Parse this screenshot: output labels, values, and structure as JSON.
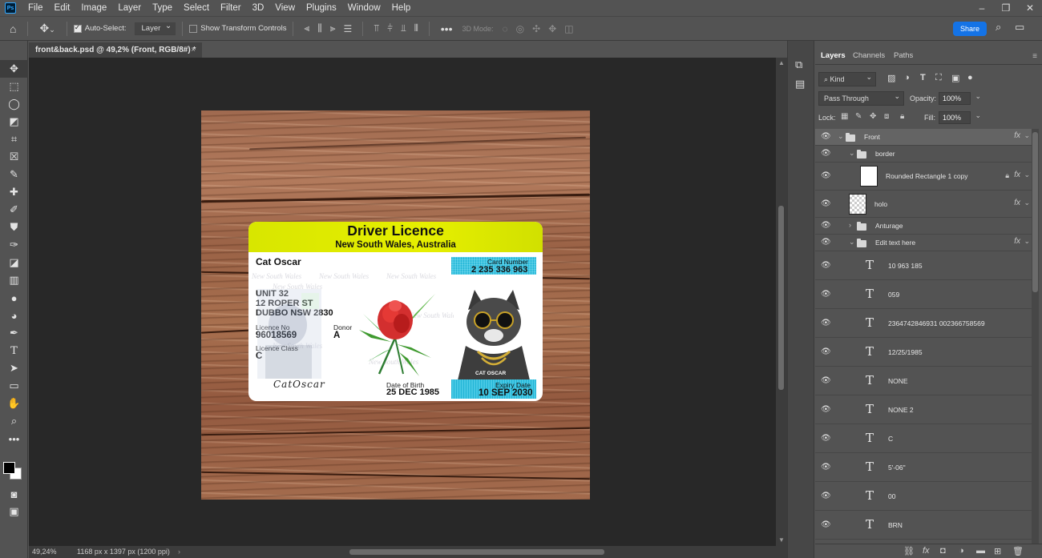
{
  "app": {
    "logo_text": "Ps"
  },
  "menu": [
    "File",
    "Edit",
    "Image",
    "Layer",
    "Type",
    "Select",
    "Filter",
    "3D",
    "View",
    "Plugins",
    "Window",
    "Help"
  ],
  "window_controls": [
    "–",
    "❐",
    "✕"
  ],
  "options": {
    "auto_select_label": "Auto-Select:",
    "auto_select_checked": true,
    "auto_select_target": "Layer",
    "transform_controls_label": "Show Transform Controls",
    "transform_controls_checked": false,
    "mode_3d_label": "3D Mode:",
    "share_label": "Share"
  },
  "document": {
    "tab_title": "front&back.psd @ 49,2% (Front, RGB/8#) *",
    "tab_close": "×",
    "zoom": "49,24%",
    "dimensions": "1168 px x 1397 px (1200 ppi)"
  },
  "licence": {
    "title": "Driver Licence",
    "subtitle": "New South Wales, Australia",
    "name": "Cat Oscar",
    "address_line1": "UNIT 32",
    "address_line2": "12 ROPER ST",
    "address_line3": "DUBBO NSW 2830",
    "licence_no_label": "Licence No",
    "licence_no": "96018569",
    "donor_label": "Donor",
    "donor": "A",
    "licence_class_label": "Licence Class",
    "licence_class": "C",
    "card_number_label": "Card Number",
    "card_number": "2 235 336 963",
    "dob_label": "Date of Birth",
    "dob": "25 DEC 1985",
    "expiry_label": "Expiry Date",
    "expiry": "10 SEP 2030",
    "signature": "CatOscar",
    "photo_caption": "CAT OSCAR",
    "watermark": "New South Wales"
  },
  "layers_panel": {
    "tabs": [
      "Layers",
      "Channels",
      "Paths"
    ],
    "active_tab": "Layers",
    "kind_filter": "Kind",
    "blend_mode": "Pass Through",
    "opacity_label": "Opacity:",
    "opacity": "100%",
    "lock_label": "Lock:",
    "fill_label": "Fill:",
    "fill": "100%",
    "layers": [
      {
        "name": "Front",
        "type": "group",
        "expanded": true,
        "fx": true,
        "selected": true
      },
      {
        "name": "border",
        "type": "group",
        "expanded": true,
        "fx": false
      },
      {
        "name": "Rounded Rectangle 1 copy",
        "type": "shape",
        "fx": true,
        "locked": true
      },
      {
        "name": "holo",
        "type": "pixel",
        "fx": true
      },
      {
        "name": "Anturage",
        "type": "group",
        "expanded": false,
        "fx": false
      },
      {
        "name": "Edit text here",
        "type": "group",
        "expanded": true,
        "fx": true
      },
      {
        "name": "10 963 185",
        "type": "text"
      },
      {
        "name": "059",
        "type": "text"
      },
      {
        "name": "2364742846931 002366758569",
        "type": "text"
      },
      {
        "name": "12/25/1985",
        "type": "text"
      },
      {
        "name": "NONE",
        "type": "text"
      },
      {
        "name": "NONE 2",
        "type": "text"
      },
      {
        "name": "C",
        "type": "text"
      },
      {
        "name": "5'-06\"",
        "type": "text"
      },
      {
        "name": "00",
        "type": "text"
      },
      {
        "name": "BRN",
        "type": "text"
      }
    ]
  },
  "colors": {
    "accent": "#1473e6",
    "panel": "#535353",
    "workspace": "#282828",
    "licence_band": "#e6ef00",
    "licence_box": "#35c0df"
  }
}
